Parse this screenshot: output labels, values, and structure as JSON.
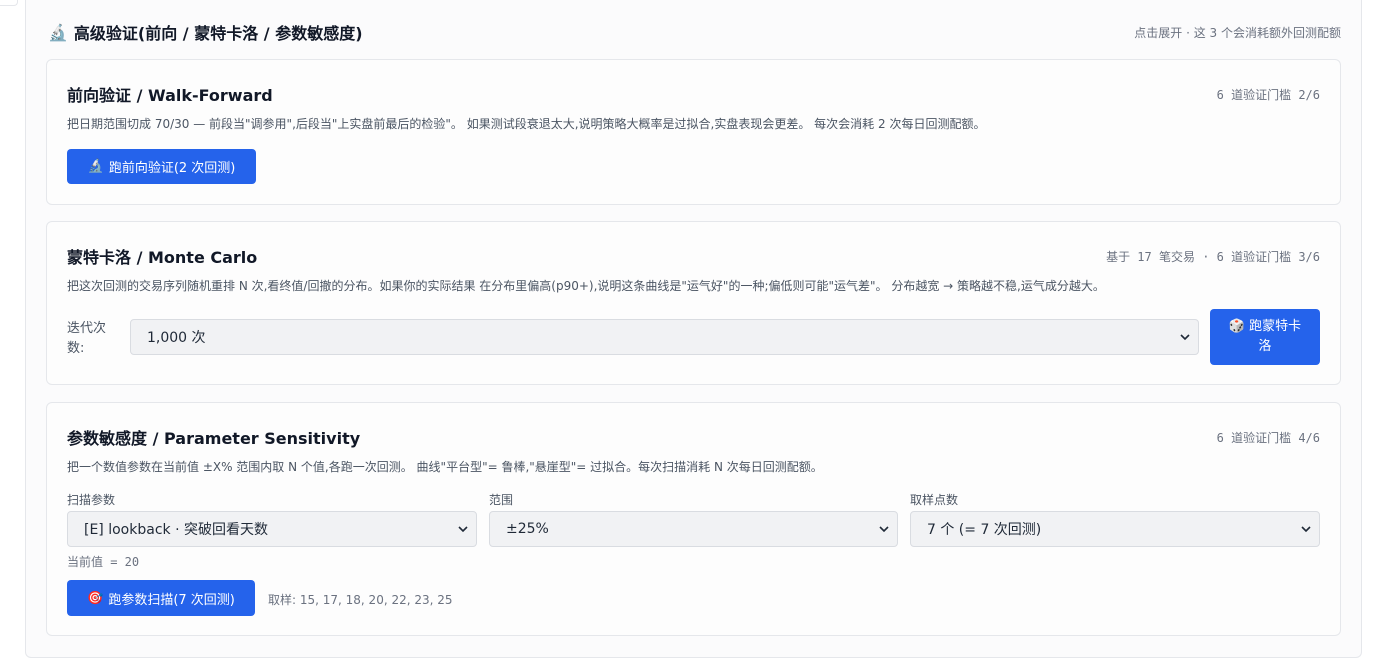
{
  "section": {
    "icon": "microscope-icon",
    "title": "高级验证(前向 / 蒙特卡洛 / 参数敏感度)",
    "hint": "点击展开 · 这 3 个会消耗额外回测配额"
  },
  "walk_forward": {
    "title": "前向验证 / Walk-Forward",
    "meta": "6 道验证门槛 2/6",
    "desc": "把日期范围切成 70/30 — 前段当\"调参用\",后段当\"上实盘前最后的检验\"。 如果测试段衰退太大,说明策略大概率是过拟合,实盘表现会更差。 每次会消耗 2 次每日回测配额。",
    "button_label": "跑前向验证(2 次回测)",
    "button_icon": "microscope-icon"
  },
  "monte_carlo": {
    "title": "蒙特卡洛 / Monte Carlo",
    "meta": "基于 17 笔交易 · 6 道验证门槛 3/6",
    "desc": "把这次回测的交易序列随机重排 N 次,看终值/回撤的分布。如果你的实际结果 在分布里偏高(p90+),说明这条曲线是\"运气好\"的一种;偏低则可能\"运气差\"。 分布越宽 → 策略越不稳,运气成分越大。",
    "iter_label_line1": "迭代次",
    "iter_label_line2": "数:",
    "iter_value": "1,000 次",
    "button_line1": "跑蒙特卡",
    "button_line2": "洛",
    "button_icon": "dice-icon"
  },
  "sensitivity": {
    "title": "参数敏感度 / Parameter Sensitivity",
    "meta": "6 道验证门槛 4/6",
    "desc": "把一个数值参数在当前值 ±X% 范围内取 N 个值,各跑一次回测。 曲线\"平台型\"= 鲁棒,\"悬崖型\"= 过拟合。每次扫描消耗 N 次每日回测配额。",
    "param_label": "扫描参数",
    "param_value": "[E] lookback · 突破回看天数",
    "range_label": "范围",
    "range_value": "±25%",
    "points_label": "取样点数",
    "points_value": "7 个 (= 7 次回测)",
    "current_value": "当前值 = 20",
    "button_label": "跑参数扫描(7 次回测)",
    "button_icon": "target-icon",
    "samples": "取样: 15, 17, 18, 20, 22, 23, 25"
  }
}
